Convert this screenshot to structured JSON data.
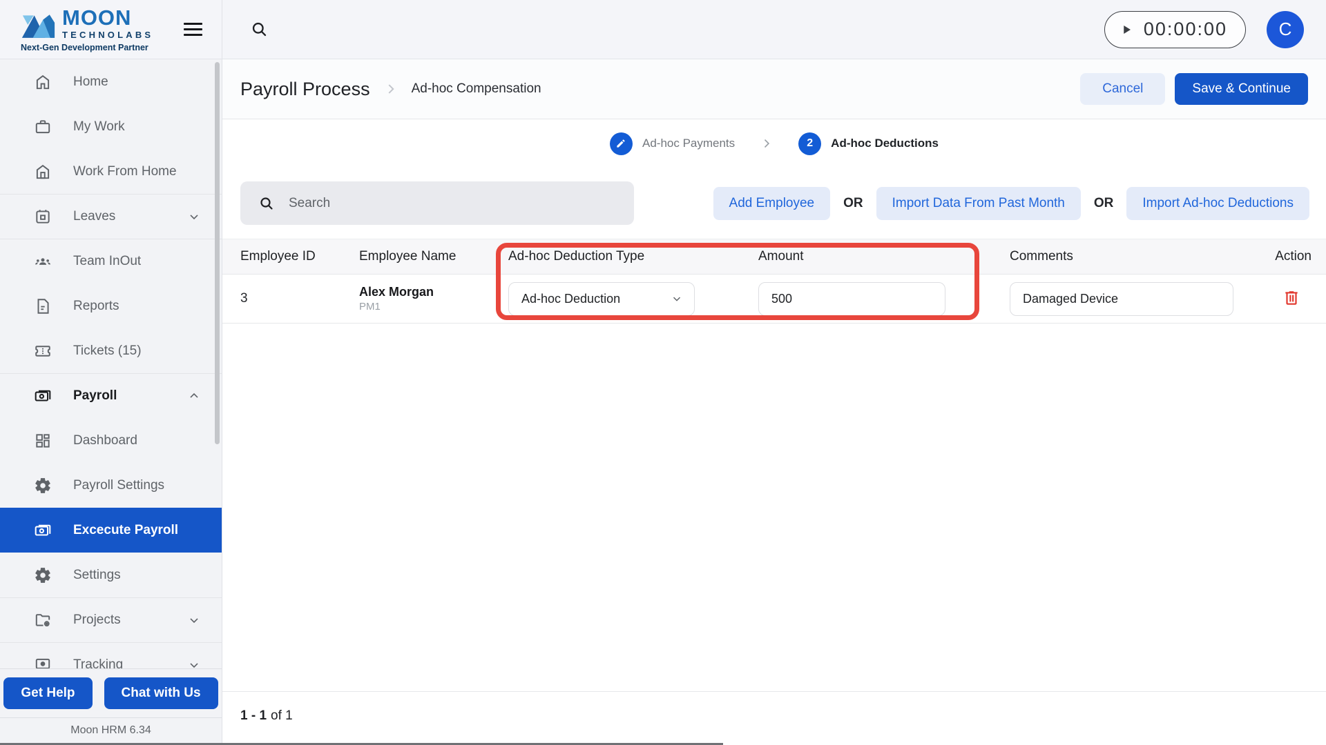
{
  "brand": {
    "name_top": "MOON",
    "name_bottom": "TECHNOLABS",
    "tagline": "Next-Gen Development Partner"
  },
  "topbar": {
    "timer": "00:00:00",
    "avatar_initial": "C"
  },
  "header": {
    "title": "Payroll Process",
    "breadcrumb": "Ad-hoc Compensation",
    "cancel_label": "Cancel",
    "save_label": "Save & Continue"
  },
  "stepper": {
    "step1_label": "Ad-hoc Payments",
    "step2_number": "2",
    "step2_label": "Ad-hoc Deductions"
  },
  "toolbar": {
    "search_placeholder": "Search",
    "add_employee": "Add Employee",
    "or1": "OR",
    "import_past_month": "Import Data From Past Month",
    "or2": "OR",
    "import_adhoc": "Import Ad-hoc Deductions"
  },
  "table": {
    "columns": [
      "Employee ID",
      "Employee Name",
      "Ad-hoc Deduction Type",
      "Amount",
      "Comments",
      "Action"
    ],
    "rows": [
      {
        "employee_id": "3",
        "employee_name": "Alex Morgan",
        "employee_code": "PM1",
        "deduction_type": "Ad-hoc Deduction",
        "amount": "500",
        "comments": "Damaged Device"
      }
    ],
    "pagination_range": "1 - 1",
    "pagination_of": "of 1"
  },
  "sidebar": {
    "items": [
      {
        "label": "Home"
      },
      {
        "label": "My Work"
      },
      {
        "label": "Work From Home"
      },
      {
        "label": "Leaves"
      },
      {
        "label": "Team InOut"
      },
      {
        "label": "Reports"
      },
      {
        "label": "Tickets (15)"
      },
      {
        "label": "Payroll"
      },
      {
        "label": "Dashboard"
      },
      {
        "label": "Payroll Settings"
      },
      {
        "label": "Excecute Payroll"
      },
      {
        "label": "Settings"
      },
      {
        "label": "Projects"
      },
      {
        "label": "Tracking"
      }
    ],
    "footer": {
      "get_help": "Get Help",
      "chat": "Chat with Us",
      "version": "Moon HRM 6.34"
    }
  },
  "colors": {
    "accent_blue": "#1556C8",
    "avatar_blue": "#1C57D9",
    "light_blue_btn": "#E4EBF9",
    "link_blue": "#2066DB",
    "highlight_red": "#E8463C",
    "sidebar_bg": "#F2F3F6",
    "topbar_bg": "#F4F5F9"
  }
}
